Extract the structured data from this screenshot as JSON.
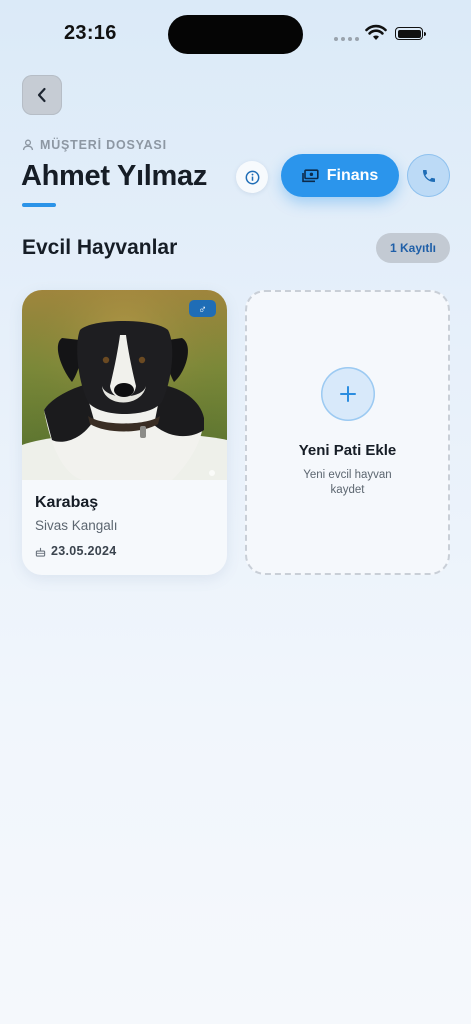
{
  "status_bar": {
    "time": "23:16"
  },
  "header": {
    "section_label": "MÜŞTERİ DOSYASI",
    "customer_name": "Ahmet Yılmaz",
    "finance_label": "Finans"
  },
  "pets_section": {
    "title": "Evcil Hayvanlar",
    "count_badge": "1 Kayıtlı",
    "pets": [
      {
        "name": "Karabaş",
        "breed": "Sivas Kangalı",
        "date": "23.05.2024",
        "gender_symbol": "♂"
      }
    ],
    "add_card": {
      "title": "Yeni Pati Ekle",
      "subtitle": "Yeni evcil hayvan kaydet"
    }
  },
  "colors": {
    "accent": "#2b95ec",
    "gender_badge": "#1f6db6",
    "badge_bg": "#c3cad3"
  },
  "icons": [
    "back-chevron-icon",
    "person-icon",
    "info-icon",
    "money-icon",
    "phone-icon",
    "male-icon",
    "cake-icon",
    "plus-icon"
  ]
}
